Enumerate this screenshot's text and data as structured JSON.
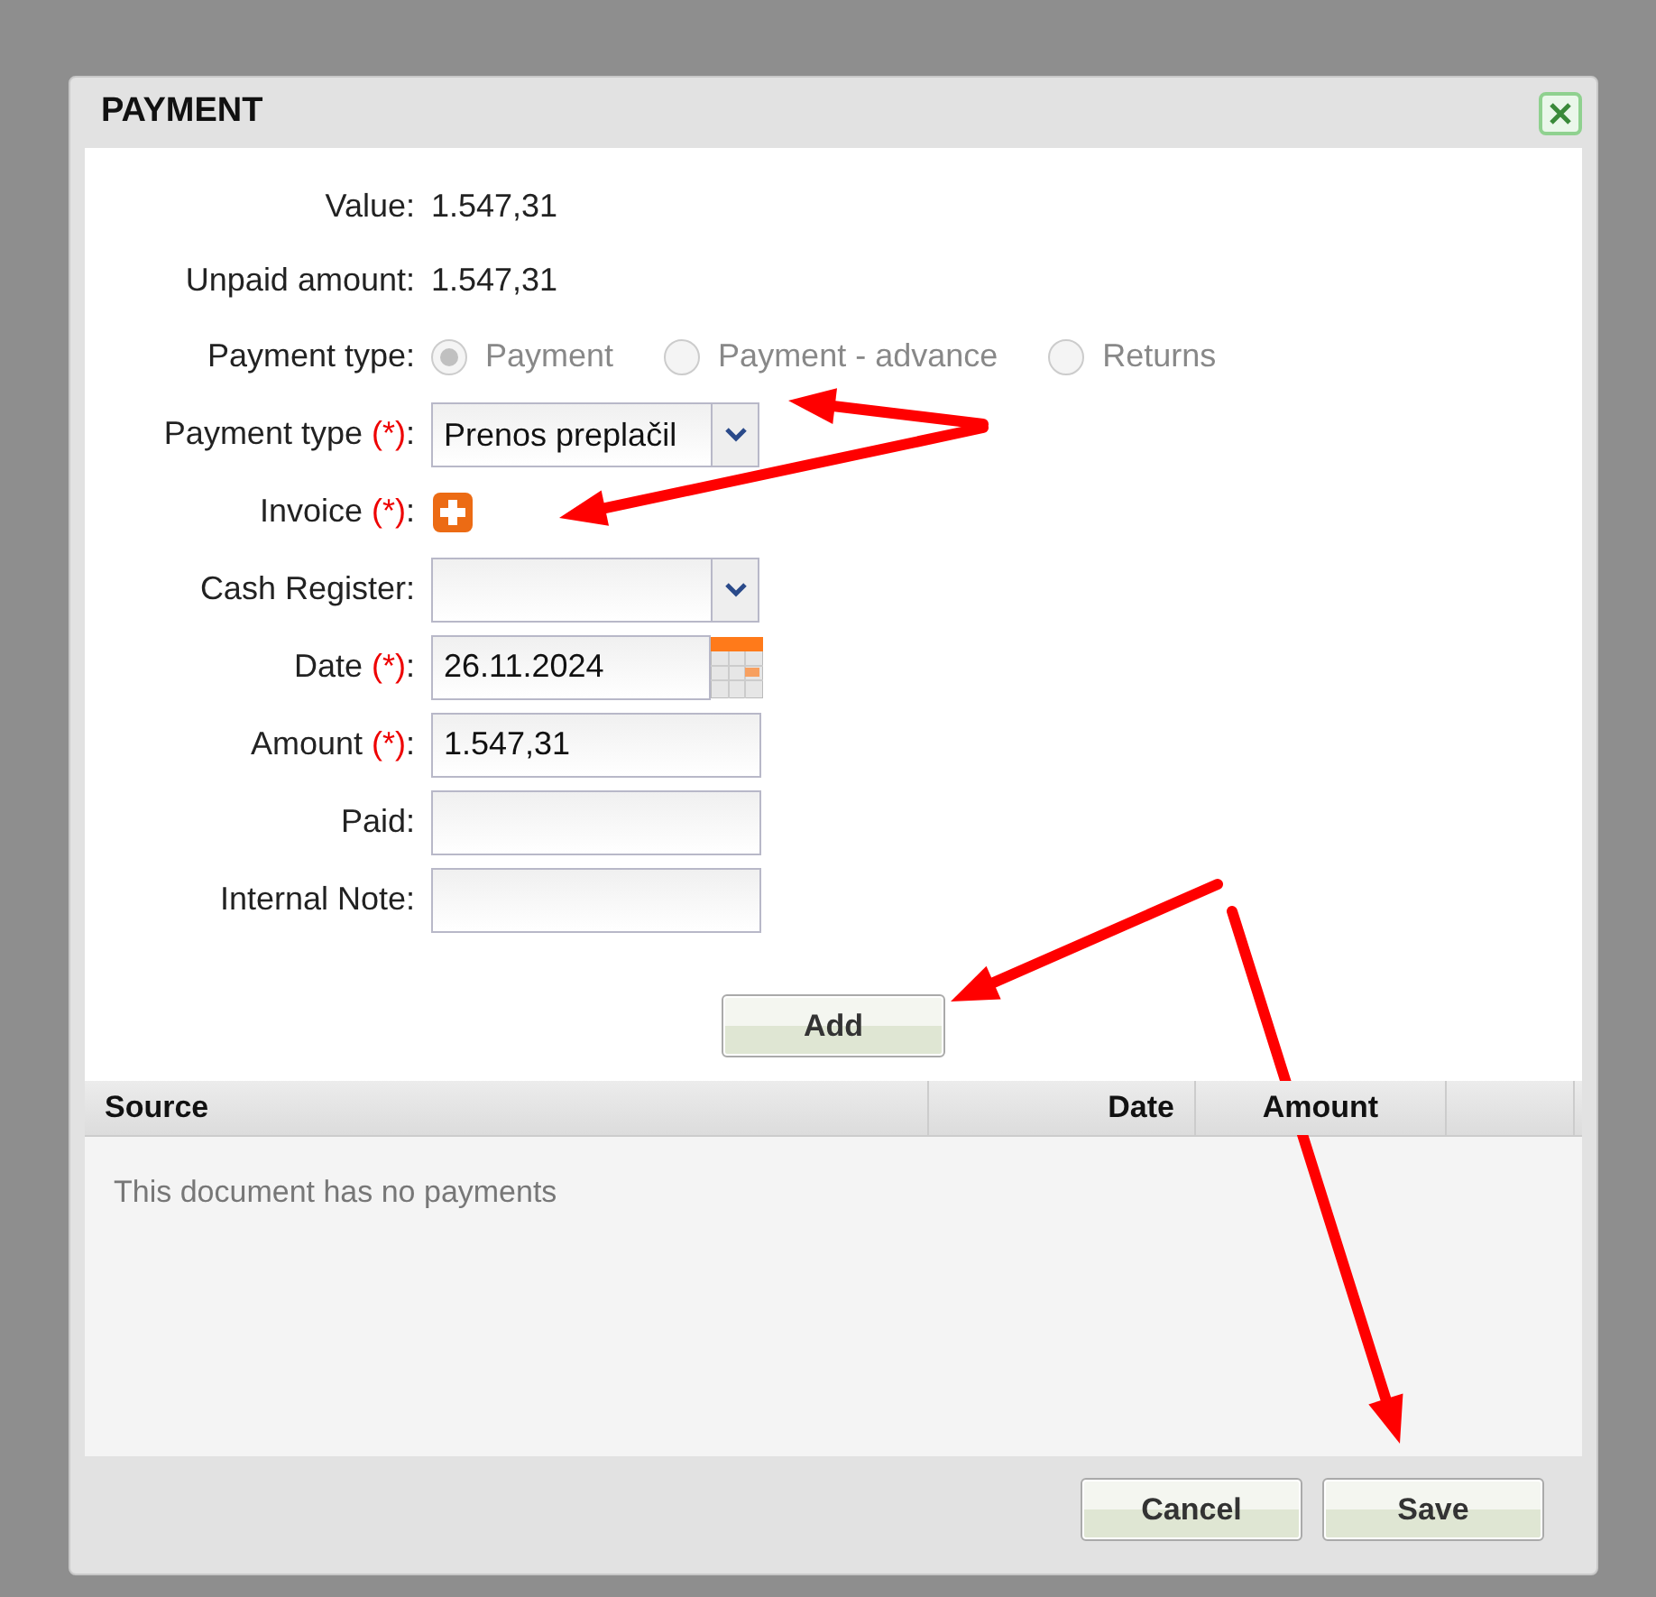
{
  "dialog": {
    "title": "PAYMENT"
  },
  "fields": [
    {
      "kind": "text",
      "label": "Value:",
      "value": "1.547,31"
    },
    {
      "kind": "text",
      "label": "Unpaid amount:",
      "value": "1.547,31"
    },
    {
      "kind": "radio",
      "label": "Payment type:",
      "disabled": true,
      "options": [
        {
          "label": "Payment",
          "selected": true
        },
        {
          "label": "Payment - advance",
          "selected": false
        },
        {
          "label": "Returns",
          "selected": false
        }
      ]
    },
    {
      "kind": "select",
      "label": "Payment type ",
      "required_mark": "(*)",
      "label_end": ":",
      "value": "Prenos preplačil"
    },
    {
      "kind": "add",
      "label": "Invoice ",
      "required_mark": "(*)",
      "label_end": ":"
    },
    {
      "kind": "select",
      "label": "Cash Register:"
    },
    {
      "kind": "date",
      "label": "Date ",
      "required_mark": "(*)",
      "label_end": ":",
      "value": "26.11.2024"
    },
    {
      "kind": "input",
      "label": "Amount ",
      "required_mark": "(*)",
      "label_end": ":",
      "value": "1.547,31"
    },
    {
      "kind": "input",
      "label": "Paid:"
    },
    {
      "kind": "input",
      "label": "Internal Note:"
    }
  ],
  "add_button": "Add",
  "table": {
    "columns": [
      "Source",
      "Date",
      "Amount"
    ],
    "empty_message": "This document has no payments"
  },
  "buttons": [
    "Cancel",
    "Save"
  ]
}
